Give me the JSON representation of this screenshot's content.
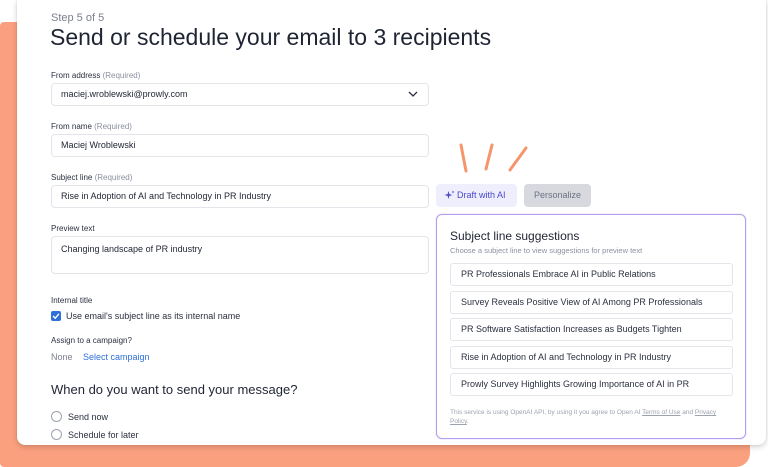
{
  "step": "Step 5 of 5",
  "title": "Send or schedule your email to 3 recipients",
  "from_address": {
    "label": "From address",
    "required": "(Required)",
    "value": "maciej.wroblewski@prowly.com"
  },
  "from_name": {
    "label": "From name",
    "required": "(Required)",
    "value": "Maciej Wroblewski"
  },
  "subject": {
    "label": "Subject line",
    "required": "(Required)",
    "value": "Rise in Adoption of AI and Technology in PR Industry"
  },
  "buttons": {
    "draft_ai": "Draft with AI",
    "personalize": "Personalize"
  },
  "preview": {
    "label": "Preview text",
    "value": "Changing landscape of PR industry"
  },
  "internal_title": {
    "label": "Internal title",
    "checkbox_label": "Use email's subject line as its internal name",
    "checked": true
  },
  "campaign": {
    "label": "Assign to a campaign?",
    "value": "None",
    "link": "Select campaign"
  },
  "send": {
    "question": "When do you want to send your message?",
    "options": [
      "Send now",
      "Schedule for later"
    ]
  },
  "suggestions": {
    "title": "Subject line suggestions",
    "subtitle": "Choose a subject line to view suggestions for preview text",
    "items": [
      "PR Professionals Embrace AI in Public Relations",
      "Survey Reveals Positive View of AI Among PR Professionals",
      "PR Software Satisfaction Increases as Budgets Tighten",
      "Rise in Adoption of AI and Technology in PR Industry",
      "Prowly Survey Highlights Growing Importance of AI in PR"
    ],
    "footer_pre": "This service is using OpenAI API, by using it you agree to Open AI ",
    "footer_terms": "Terms of Use",
    "footer_and": " and ",
    "footer_privacy": "Privacy Policy",
    "footer_end": "."
  },
  "colors": {
    "accent": "#2f6fd8",
    "ai": "#4a49c7",
    "orange": "#fba07e",
    "panel_border": "#b49cf0"
  }
}
